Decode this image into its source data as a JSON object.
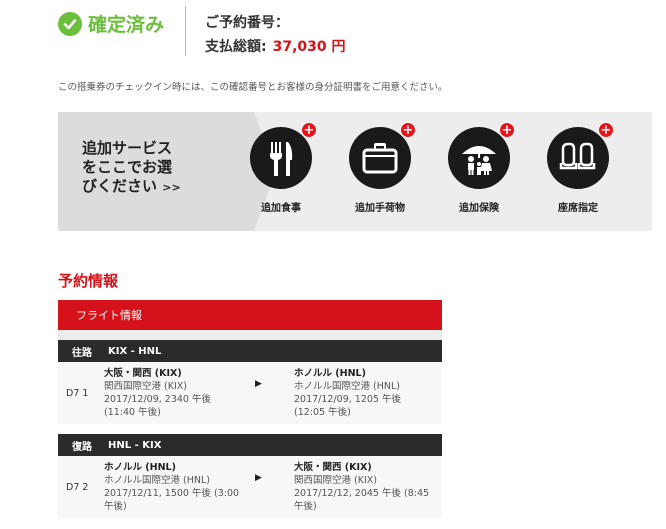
{
  "status": {
    "label": "確定済み"
  },
  "booking": {
    "number_label": "ご予約番号：",
    "total_label": "支払総額:",
    "total_amount": "37,030 円"
  },
  "notice": "この搭乗券のチェックイン時には、この確認番号とお客様の身分証明書をご用意ください。",
  "banner": {
    "title_line1": "追加サービス",
    "title_line2": "をここでお選",
    "title_line3": "びください",
    "chevron": ">>",
    "services": [
      {
        "label": "追加食事",
        "icon": "fork-knife-icon"
      },
      {
        "label": "追加手荷物",
        "icon": "luggage-icon"
      },
      {
        "label": "追加保険",
        "icon": "insurance-umbrella-icon"
      },
      {
        "label": "座席指定",
        "icon": "seat-icon"
      }
    ]
  },
  "reservation": {
    "title": "予約情報",
    "flight_header": "フライト情報",
    "outbound": {
      "kind": "往路",
      "route": "KIX - HNL",
      "flight_no": "D7 1",
      "depart_city": "大阪・関西 (KIX)",
      "depart_airport": "関西国際空港 (KIX)",
      "depart_time": "2017/12/09, 2340 午後 (11:40 午後)",
      "arrive_city": "ホノルル (HNL)",
      "arrive_airport": "ホノルル国際空港 (HNL)",
      "arrive_time": "2017/12/09, 1205 午後 (12:05 午後)"
    },
    "return": {
      "kind": "復路",
      "route": "HNL - KIX",
      "flight_no": "D7 2",
      "depart_city": "ホノルル (HNL)",
      "depart_airport": "ホノルル国際空港 (HNL)",
      "depart_time": "2017/12/11, 1500 午後 (3:00 午後)",
      "arrive_city": "大阪・関西 (KIX)",
      "arrive_airport": "関西国際空港 (KIX)",
      "arrive_time": "2017/12/12, 2045 午後 (8:45 午後)"
    }
  },
  "colors": {
    "accent_red": "#d5111a",
    "confirm_green": "#6bbf3b",
    "dark": "#1a1a1a"
  }
}
